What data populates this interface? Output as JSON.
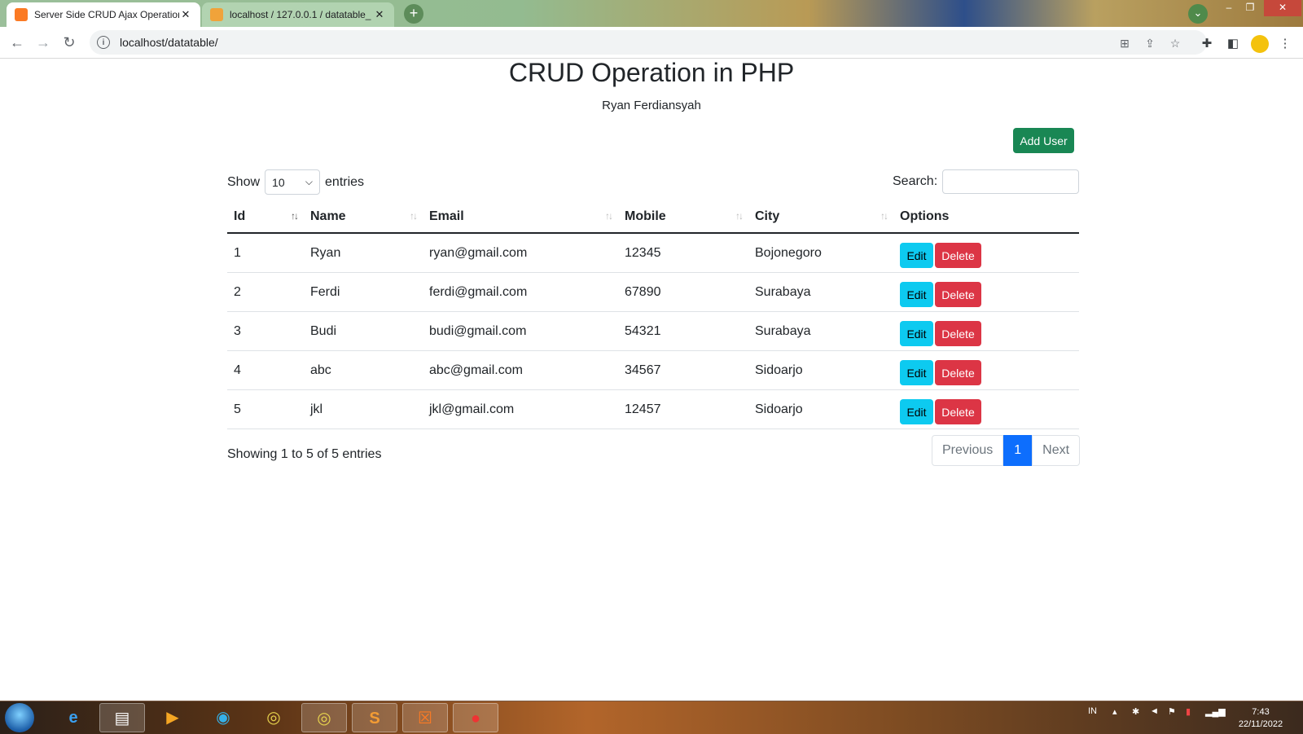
{
  "browser": {
    "tabs": [
      {
        "title": "Server Side CRUD Ajax Operation",
        "active": true
      },
      {
        "title": "localhost / 127.0.0.1 / datatable_",
        "active": false
      }
    ],
    "url": "localhost/datatable/"
  },
  "page": {
    "title": "CRUD Operation in PHP",
    "subtitle": "Ryan Ferdiansyah",
    "add_button": "Add User"
  },
  "table_controls": {
    "show_label": "Show",
    "entries_label": "entries",
    "page_length": "10",
    "search_label": "Search:"
  },
  "columns": [
    "Id",
    "Name",
    "Email",
    "Mobile",
    "City",
    "Options"
  ],
  "rows": [
    {
      "id": "1",
      "name": "Ryan",
      "email": "ryan@gmail.com",
      "mobile": "12345",
      "city": "Bojonegoro"
    },
    {
      "id": "2",
      "name": "Ferdi",
      "email": "ferdi@gmail.com",
      "mobile": "67890",
      "city": "Surabaya"
    },
    {
      "id": "3",
      "name": "Budi",
      "email": "budi@gmail.com",
      "mobile": "54321",
      "city": "Surabaya"
    },
    {
      "id": "4",
      "name": "abc",
      "email": "abc@gmail.com",
      "mobile": "34567",
      "city": "Sidoarjo"
    },
    {
      "id": "5",
      "name": "jkl",
      "email": "jkl@gmail.com",
      "mobile": "12457",
      "city": "Sidoarjo"
    }
  ],
  "row_actions": {
    "edit": "Edit",
    "delete": "Delete"
  },
  "footer": {
    "info": "Showing 1 to 5 of 5 entries",
    "previous": "Previous",
    "current_page": "1",
    "next": "Next"
  },
  "taskbar": {
    "language": "IN",
    "time": "7:43",
    "date": "22/11/2022"
  },
  "colors": {
    "add_button": "#198754",
    "edit_button": "#0dcaf0",
    "delete_button": "#dc3545",
    "active_page": "#0d6efd"
  }
}
